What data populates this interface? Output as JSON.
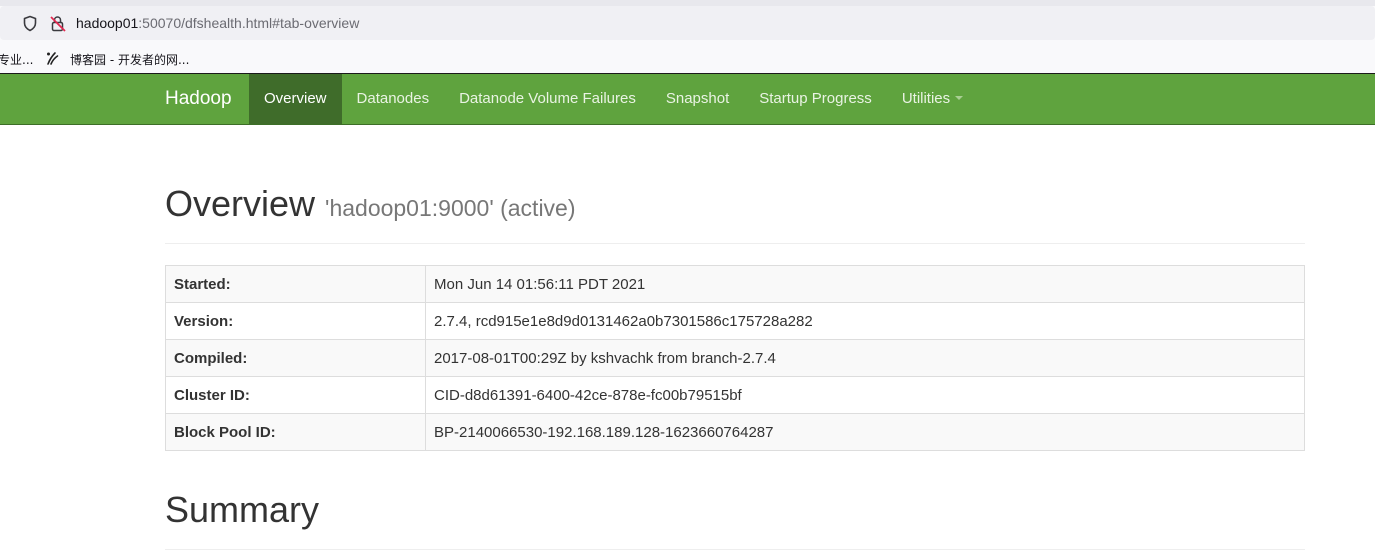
{
  "browser": {
    "url_host": "hadoop01",
    "url_rest": ":50070/dfshealth.html#tab-overview",
    "bookmarks": [
      {
        "label": "专业..."
      },
      {
        "label": "博客园 - 开发者的网...",
        "icon": "cnblogs-icon"
      }
    ]
  },
  "navbar": {
    "brand": "Hadoop",
    "items": [
      {
        "label": "Overview",
        "active": true
      },
      {
        "label": "Datanodes"
      },
      {
        "label": "Datanode Volume Failures"
      },
      {
        "label": "Snapshot"
      },
      {
        "label": "Startup Progress"
      },
      {
        "label": "Utilities"
      }
    ]
  },
  "overview": {
    "title": "Overview",
    "subtitle": "'hadoop01:9000' (active)",
    "rows": [
      {
        "key": "Started:",
        "value": "Mon Jun 14 01:56:11 PDT 2021"
      },
      {
        "key": "Version:",
        "value": "2.7.4, rcd915e1e8d9d0131462a0b7301586c175728a282"
      },
      {
        "key": "Compiled:",
        "value": "2017-08-01T00:29Z by kshvachk from branch-2.7.4"
      },
      {
        "key": "Cluster ID:",
        "value": "CID-d8d61391-6400-42ce-878e-fc00b79515bf"
      },
      {
        "key": "Block Pool ID:",
        "value": "BP-2140066530-192.168.189.128-1623660764287"
      }
    ]
  },
  "summary": {
    "title": "Summary"
  },
  "colors": {
    "navbar_bg": "#5fa33e",
    "navbar_active_bg": "#3f6c2a"
  }
}
